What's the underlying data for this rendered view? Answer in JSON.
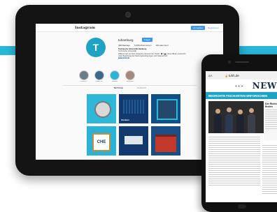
{
  "colors": {
    "accent": "#27b8d8",
    "instagram_blue": "#3897f0",
    "dark_navy": "#1c2a4a"
  },
  "tablet": {
    "app_title": "Instagram",
    "login_label": "Anmelden",
    "register_label": "Registrieren",
    "profile": {
      "username": "tuhamburg",
      "follow_label": "Folgen",
      "stats": {
        "posts": "498 Beiträge",
        "followers": "6.688 Abonnenten",
        "following": "183 abonniert"
      },
      "bio": {
        "name": "Technische Universität Hamburg",
        "line1": "Technische Universität",
        "line2": "Willkommen auf dem Instagram-Account der TUHH. 🎓 | 📸 | Eure Bilder erwünscht",
        "line3": "unter Beachtung der Nutzungsbedingungen und Datenschutz.",
        "link": "www.tuhh.de"
      }
    },
    "highlights": [
      {
        "label": "TUHH Fo..."
      },
      {
        "label": "Career Ta..."
      },
      {
        "label": "Studium"
      },
      {
        "label": "Erasmus+"
      }
    ],
    "tabs": {
      "posts": "BEITRÄGE",
      "tagged": "MARKIERT"
    },
    "posts": [
      {
        "caption": "",
        "icon": "compass"
      },
      {
        "caption": "Studium",
        "icon": "bars"
      },
      {
        "caption": "",
        "icon": "frame"
      },
      {
        "caption": "CHE",
        "icon": "certificate"
      },
      {
        "caption": "",
        "icon": "ship"
      },
      {
        "caption": "",
        "icon": "building"
      }
    ]
  },
  "phone": {
    "aa_label": "aA",
    "url": "tuhh.de",
    "news_plus": "+ + +",
    "news_title": "NEWS",
    "banner": "BEDROHTE FISCHARTEN ERFORSCHEN",
    "sidebar_title": "Die Richtung finden"
  }
}
